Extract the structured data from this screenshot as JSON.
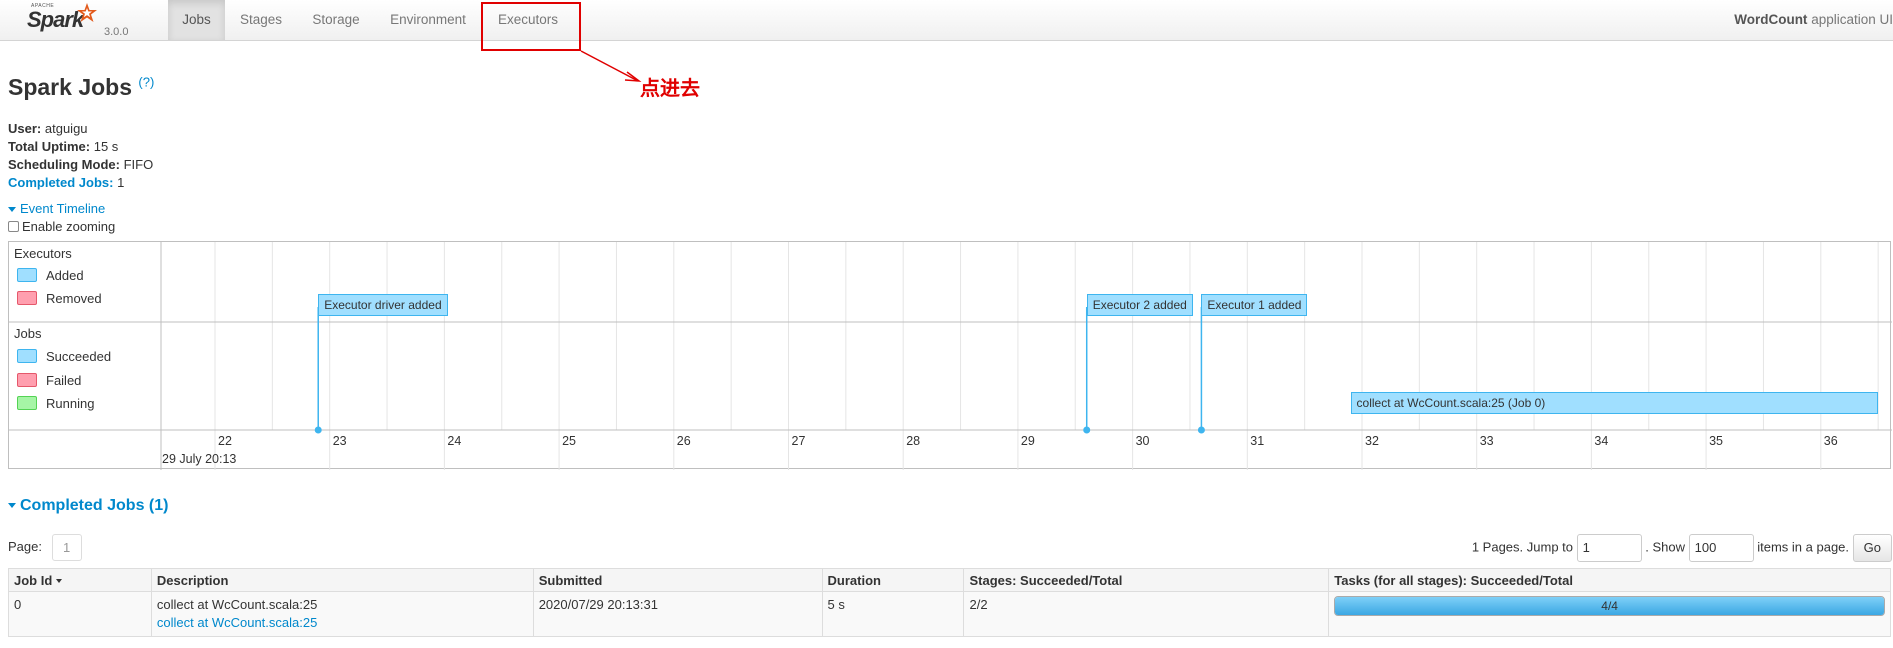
{
  "brand": {
    "apache": "APACHE",
    "name": "Spark",
    "version": "3.0.0"
  },
  "nav": {
    "tabs": [
      {
        "label": "Jobs"
      },
      {
        "label": "Stages"
      },
      {
        "label": "Storage"
      },
      {
        "label": "Environment"
      },
      {
        "label": "Executors"
      }
    ],
    "active_tab": "Jobs",
    "app_name": "WordCount",
    "app_suffix": " application UI"
  },
  "annotation": {
    "text": "点进去",
    "color": "#e00000"
  },
  "page": {
    "title": "Spark Jobs",
    "help": "(?)"
  },
  "summary": {
    "user_label": "User:",
    "user": "atguigu",
    "uptime_label": "Total Uptime:",
    "uptime": "15 s",
    "mode_label": "Scheduling Mode:",
    "mode": "FIFO",
    "completed_label": "Completed Jobs:",
    "completed": "1"
  },
  "timeline": {
    "toggle_label": "Event Timeline",
    "zoom_label": "Enable zooming",
    "executors_group": "Executors",
    "executor_legend": [
      {
        "label": "Added",
        "color": "#a0dfff",
        "border": "#3eb5ef"
      },
      {
        "label": "Removed",
        "color": "#ff9faf",
        "border": "#e5586b"
      }
    ],
    "jobs_group": "Jobs",
    "job_legend": [
      {
        "label": "Succeeded",
        "color": "#a0dfff",
        "border": "#3eb5ef"
      },
      {
        "label": "Failed",
        "color": "#ff9faf",
        "border": "#e5586b"
      },
      {
        "label": "Running",
        "color": "#a6f5a6",
        "border": "#54d354"
      }
    ],
    "date_label": "29 July 20:13",
    "ticks": [
      "22",
      "23",
      "24",
      "25",
      "26",
      "27",
      "28",
      "29",
      "30",
      "31",
      "32",
      "33",
      "34",
      "35",
      "36"
    ],
    "executor_events": [
      {
        "label": "Executor driver added",
        "second": 22.9
      },
      {
        "label": "Executor 2 added",
        "second": 29.6
      },
      {
        "label": "Executor 1 added",
        "second": 30.6
      }
    ],
    "job_bars": [
      {
        "label": "collect at WcCount.scala:25 (Job 0)",
        "start": 31.9,
        "end": 36.5
      }
    ]
  },
  "completed_section": {
    "title": "Completed Jobs (1)"
  },
  "pagination": {
    "page_label": "Page:",
    "current_page": "1",
    "pages_text": "1 Pages. Jump to",
    "jump_value": "1",
    "show_text": ". Show",
    "show_value": "100",
    "items_text": "items in a page.",
    "go_label": "Go"
  },
  "jobs_table": {
    "columns": [
      "Job Id",
      "Description",
      "Submitted",
      "Duration",
      "Stages: Succeeded/Total",
      "Tasks (for all stages): Succeeded/Total"
    ],
    "rows": [
      {
        "job_id": "0",
        "description": "collect at WcCount.scala:25",
        "description_link": "collect at WcCount.scala:25",
        "submitted": "2020/07/29 20:13:31",
        "duration": "5 s",
        "stages": "2/2",
        "tasks": "4/4",
        "tasks_progress": 1.0
      }
    ]
  }
}
